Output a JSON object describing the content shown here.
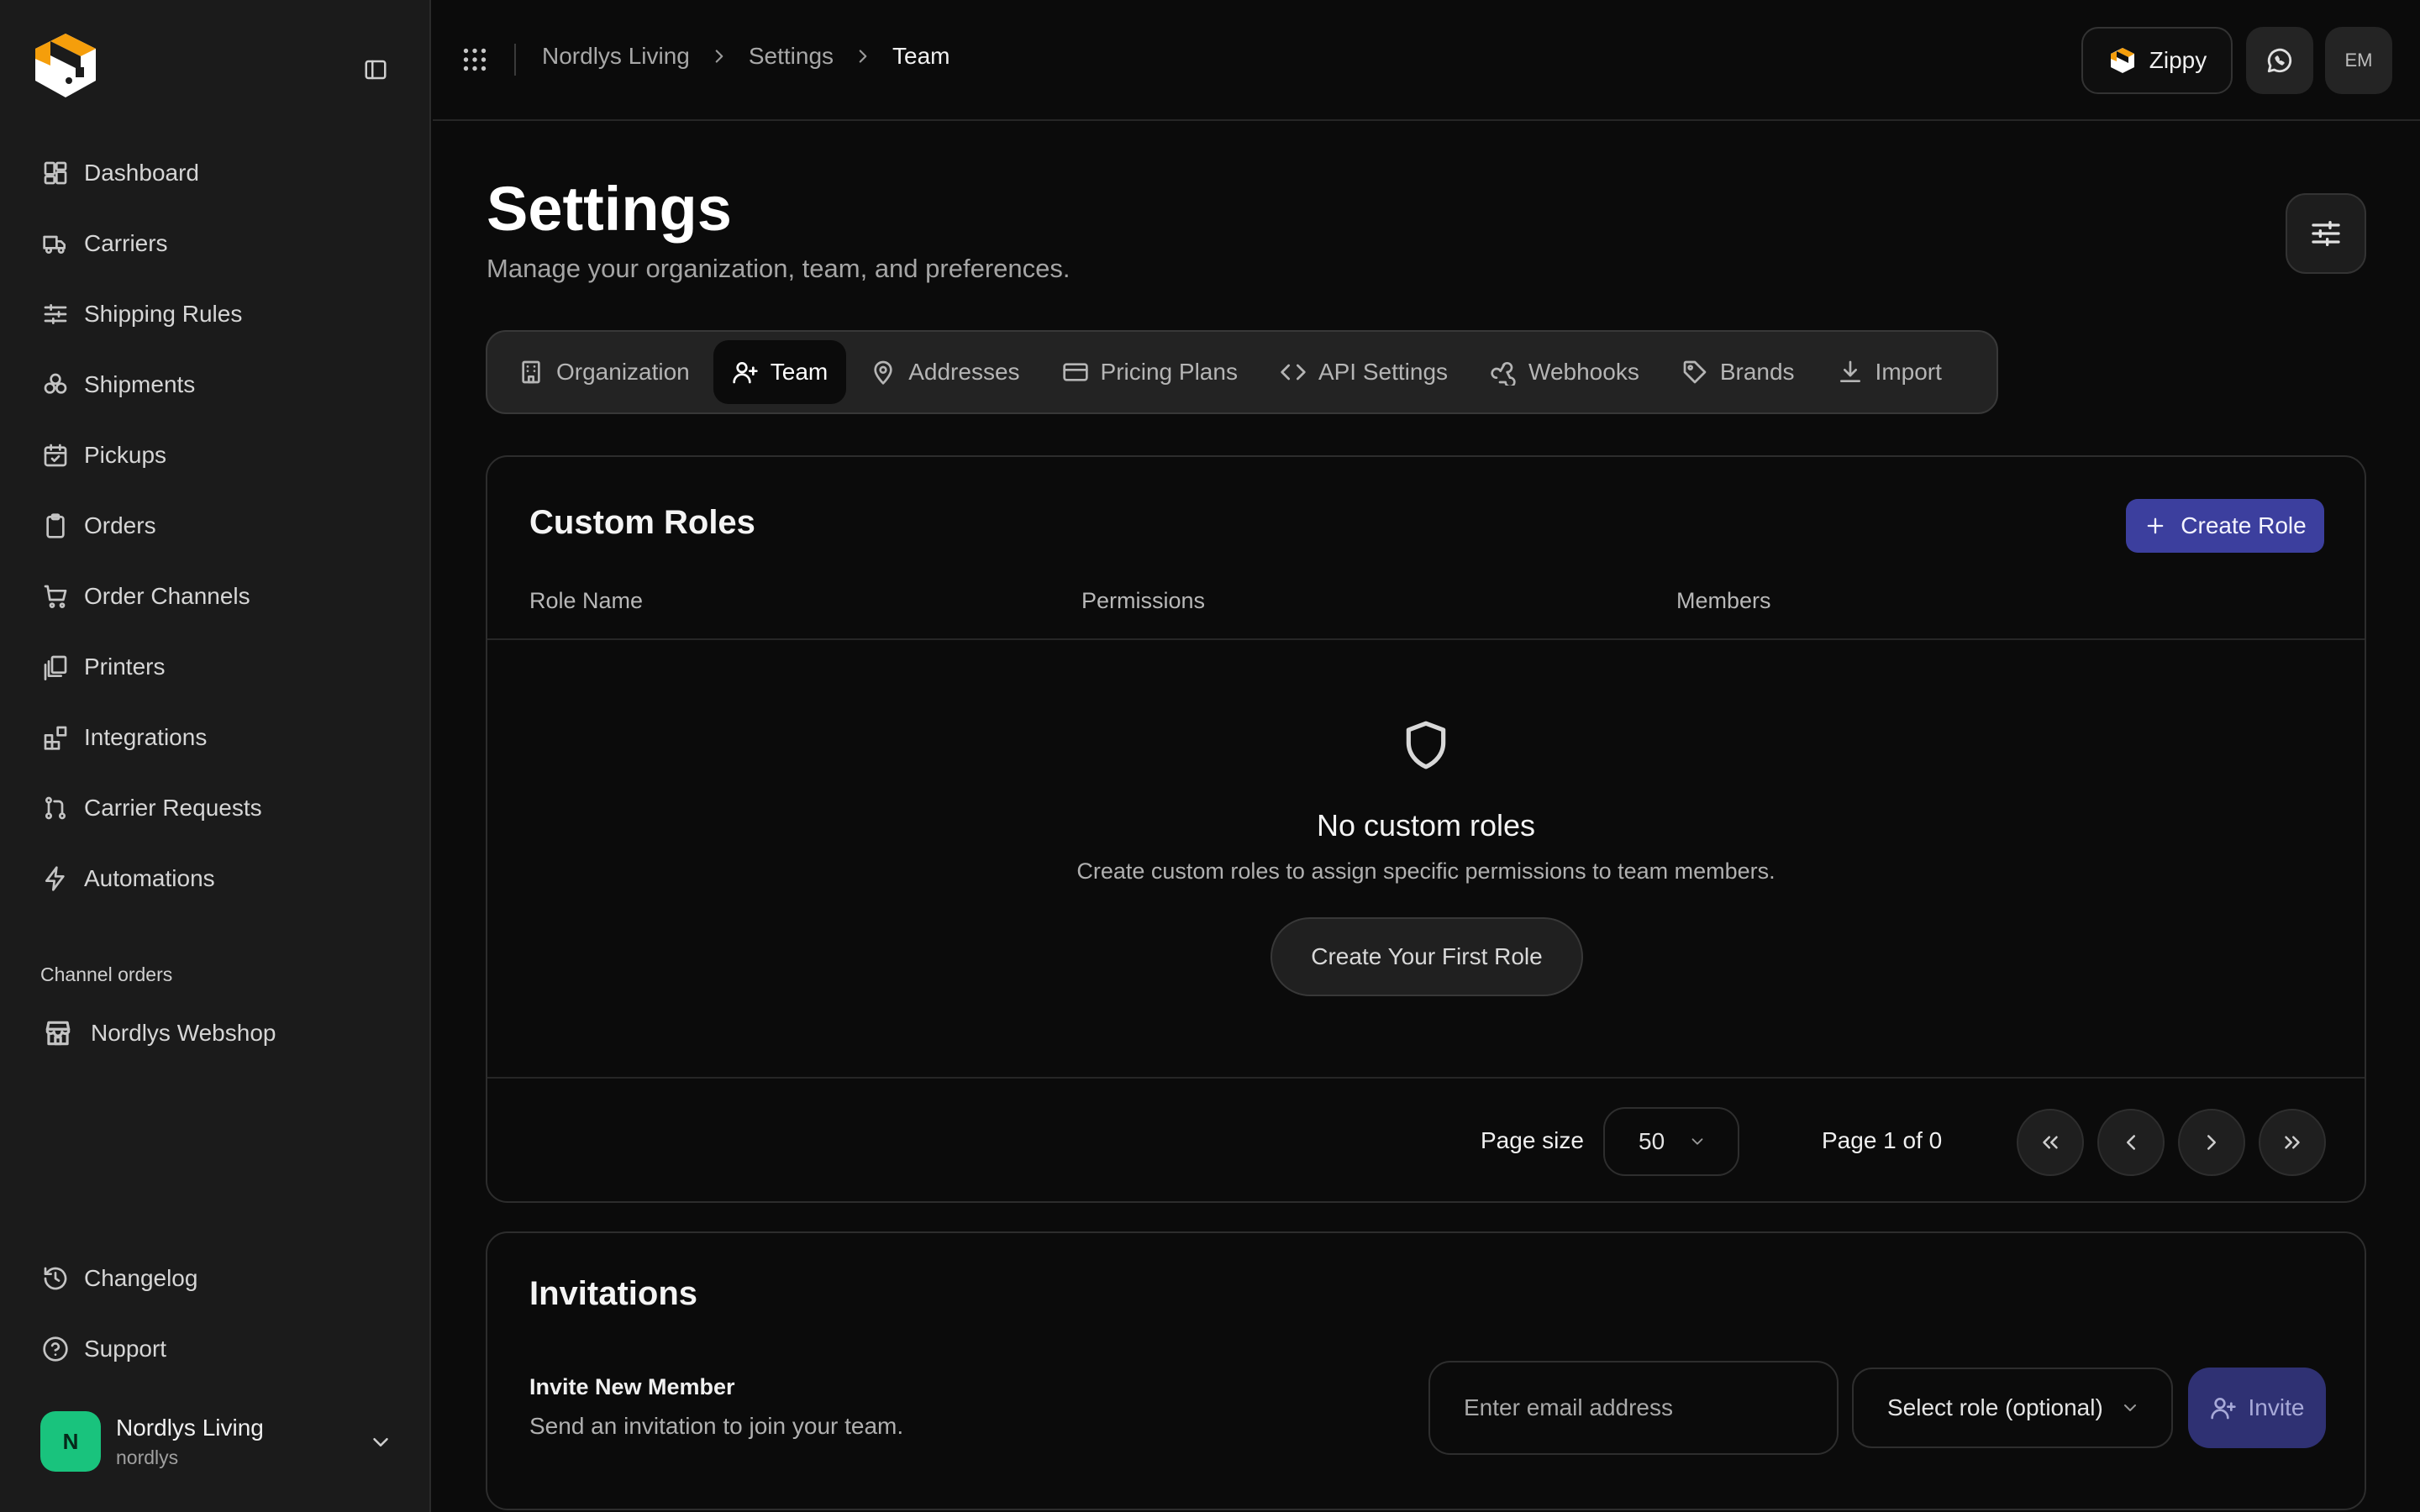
{
  "sidebar": {
    "items": [
      {
        "label": "Dashboard",
        "icon": "layout-dashboard-icon"
      },
      {
        "label": "Carriers",
        "icon": "truck-icon"
      },
      {
        "label": "Shipping Rules",
        "icon": "sliders-icon"
      },
      {
        "label": "Shipments",
        "icon": "boxes-icon"
      },
      {
        "label": "Pickups",
        "icon": "calendar-check-icon"
      },
      {
        "label": "Orders",
        "icon": "clipboard-icon"
      },
      {
        "label": "Order Channels",
        "icon": "shopping-cart-icon"
      },
      {
        "label": "Printers",
        "icon": "printer-stack-icon"
      },
      {
        "label": "Integrations",
        "icon": "blocks-icon"
      },
      {
        "label": "Carrier Requests",
        "icon": "git-pull-request-icon"
      },
      {
        "label": "Automations",
        "icon": "zap-icon"
      }
    ],
    "section_label": "Channel orders",
    "channel": {
      "label": "Nordlys Webshop",
      "icon": "store-icon"
    },
    "bottom_items": [
      {
        "label": "Changelog",
        "icon": "history-icon"
      },
      {
        "label": "Support",
        "icon": "help-circle-icon"
      }
    ],
    "user": {
      "initial": "N",
      "name": "Nordlys Living",
      "handle": "nordlys"
    }
  },
  "topbar": {
    "breadcrumb": [
      "Nordlys Living",
      "Settings",
      "Team"
    ],
    "zippy_label": "Zippy",
    "avatar_initials": "EM"
  },
  "page": {
    "title": "Settings",
    "subtitle": "Manage your organization, team, and preferences."
  },
  "tabs": [
    {
      "label": "Organization",
      "icon": "building-icon",
      "active": false
    },
    {
      "label": "Team",
      "icon": "user-plus-icon",
      "active": true
    },
    {
      "label": "Addresses",
      "icon": "map-pin-icon",
      "active": false
    },
    {
      "label": "Pricing Plans",
      "icon": "credit-card-icon",
      "active": false
    },
    {
      "label": "API Settings",
      "icon": "code-icon",
      "active": false
    },
    {
      "label": "Webhooks",
      "icon": "webhook-icon",
      "active": false
    },
    {
      "label": "Brands",
      "icon": "tag-icon",
      "active": false
    },
    {
      "label": "Import",
      "icon": "download-icon",
      "active": false
    }
  ],
  "roles": {
    "title": "Custom Roles",
    "create_label": "Create Role",
    "columns": [
      "Role Name",
      "Permissions",
      "Members"
    ],
    "empty_title": "No custom roles",
    "empty_sub": "Create custom roles to assign specific permissions to team members.",
    "empty_cta": "Create Your First Role",
    "pagination": {
      "page_size_label": "Page size",
      "page_size": "50",
      "page_info": "Page 1 of 0"
    }
  },
  "invitations": {
    "title": "Invitations",
    "invite_label": "Invite New Member",
    "invite_sub": "Send an invitation to join your team.",
    "email_placeholder": "Enter email address",
    "role_placeholder": "Select role (optional)",
    "invite_button": "Invite"
  },
  "colors": {
    "accent": "#3c3f9e",
    "avatar_green": "#19c37d",
    "logo_orange": "#f59e0b"
  }
}
